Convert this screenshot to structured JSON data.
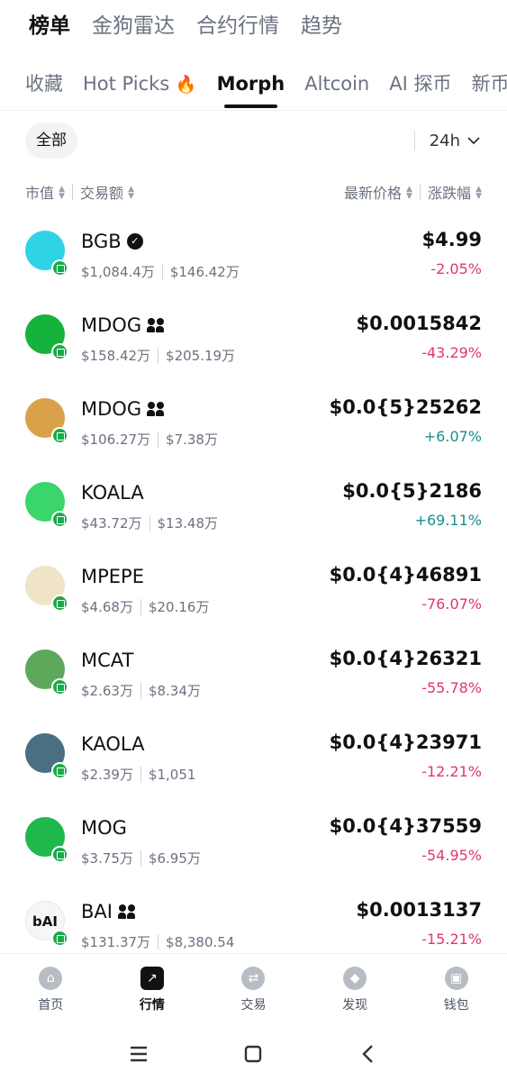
{
  "top_tabs": [
    "榜单",
    "金狗雷达",
    "合约行情",
    "趋势"
  ],
  "sub_tabs": [
    "收藏",
    "Hot Picks",
    "Morph",
    "Altcoin",
    "AI 探币",
    "新币"
  ],
  "filter": {
    "chip": "全部",
    "period": "24h"
  },
  "columns": {
    "mcap": "市值",
    "volume": "交易额",
    "price": "最新价格",
    "change": "涨跌幅"
  },
  "tokens": [
    {
      "symbol": "BGB",
      "mcap": "$1,084.4万",
      "volume": "$146.42万",
      "price": "$4.99",
      "change": "-2.05%",
      "dir": "neg",
      "badge": "verified",
      "avatar": "#2fd3e6"
    },
    {
      "symbol": "MDOG",
      "mcap": "$158.42万",
      "volume": "$205.19万",
      "price": "$0.0015842",
      "change": "-43.29%",
      "dir": "neg",
      "badge": "people",
      "avatar": "#16b33c"
    },
    {
      "symbol": "MDOG",
      "mcap": "$106.27万",
      "volume": "$7.38万",
      "price": "$0.0{5}25262",
      "change": "+6.07%",
      "dir": "pos",
      "badge": "people",
      "avatar": "#d9a24a"
    },
    {
      "symbol": "KOALA",
      "mcap": "$43.72万",
      "volume": "$13.48万",
      "price": "$0.0{5}2186",
      "change": "+69.11%",
      "dir": "pos",
      "badge": "",
      "avatar": "#3ad66b"
    },
    {
      "symbol": "MPEPE",
      "mcap": "$4.68万",
      "volume": "$20.16万",
      "price": "$0.0{4}46891",
      "change": "-76.07%",
      "dir": "neg",
      "badge": "",
      "avatar": "#efe4c8"
    },
    {
      "symbol": "MCAT",
      "mcap": "$2.63万",
      "volume": "$8.34万",
      "price": "$0.0{4}26321",
      "change": "-55.78%",
      "dir": "neg",
      "badge": "",
      "avatar": "#5da85b"
    },
    {
      "symbol": "KAOLA",
      "mcap": "$2.39万",
      "volume": "$1,051",
      "price": "$0.0{4}23971",
      "change": "-12.21%",
      "dir": "neg",
      "badge": "",
      "avatar": "#4a6f82"
    },
    {
      "symbol": "MOG",
      "mcap": "$3.75万",
      "volume": "$6.95万",
      "price": "$0.0{4}37559",
      "change": "-54.95%",
      "dir": "neg",
      "badge": "",
      "avatar": "#1fb84a"
    },
    {
      "symbol": "BAI",
      "mcap": "$131.37万",
      "volume": "$8,380.54",
      "price": "$0.0013137",
      "change": "-15.21%",
      "dir": "neg",
      "badge": "people",
      "avatar": "#f4f6f8",
      "avatar_text": "bAI"
    }
  ],
  "bottom_nav": [
    {
      "label": "首页",
      "icon": "home-icon"
    },
    {
      "label": "行情",
      "icon": "market-chart-icon"
    },
    {
      "label": "交易",
      "icon": "trade-icon"
    },
    {
      "label": "发现",
      "icon": "discover-icon"
    },
    {
      "label": "钱包",
      "icon": "wallet-icon"
    }
  ],
  "active_top_tab": 0,
  "active_sub_tab": 2,
  "active_nav": 1
}
